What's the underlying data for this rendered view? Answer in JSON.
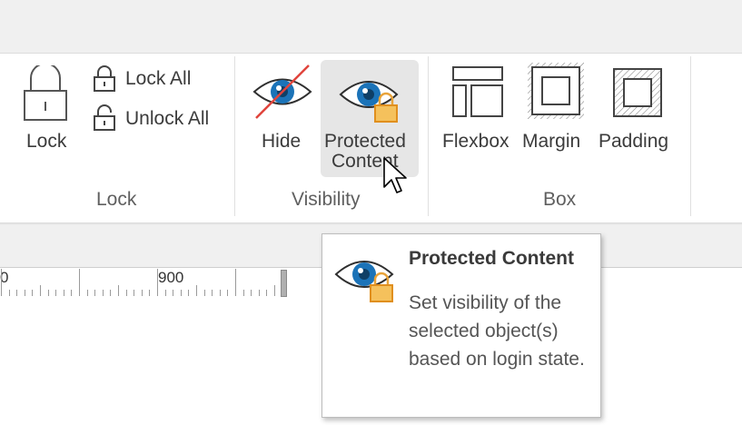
{
  "ribbon": {
    "lock_group": {
      "label": "Lock",
      "lock_button": "Lock",
      "lock_all": "Lock All",
      "unlock_all": "Unlock All"
    },
    "visibility_group": {
      "label": "Visibility",
      "hide": "Hide",
      "protected_line1": "Protected",
      "protected_line2": "Content"
    },
    "box_group": {
      "label": "Box",
      "flexbox": "Flexbox",
      "margin": "Margin",
      "padding": "Padding"
    }
  },
  "ruler": {
    "label_left": "0",
    "label_900": "900"
  },
  "tooltip": {
    "title": "Protected Content",
    "description": "Set visibility of the selected object(s) based on login state."
  },
  "colors": {
    "icon_blue": "#1b73b8",
    "lock_orange": "#e8a33a",
    "hide_slash": "#e0443c",
    "hover_bg": "#e6e6e6"
  }
}
